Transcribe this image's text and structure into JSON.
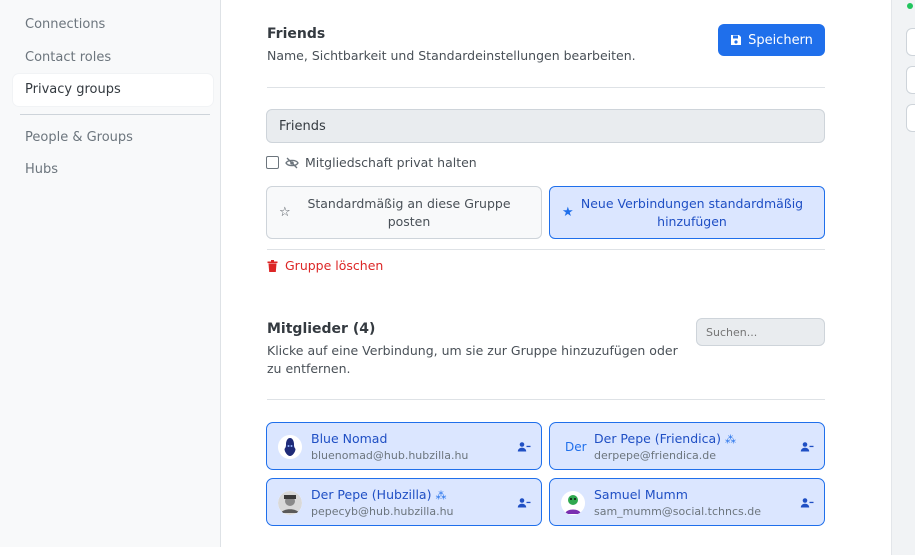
{
  "sidebar": {
    "items": [
      {
        "label": "Connections",
        "active": false
      },
      {
        "label": "Contact roles",
        "active": false
      },
      {
        "label": "Privacy groups",
        "active": true
      },
      {
        "label": "People & Groups",
        "active": false
      },
      {
        "label": "Hubs",
        "active": false
      }
    ]
  },
  "header": {
    "title": "Friends",
    "subtitle": "Name, Sichtbarkeit und Standardeinstellungen bearbeiten.",
    "save_label": "Speichern"
  },
  "group_form": {
    "name_value": "Friends",
    "private_membership_label": "Mitgliedschaft privat halten",
    "private_membership_checked": false,
    "default_post_label": "Standardmäßig an diese Gruppe posten",
    "default_post_active": false,
    "default_post_icon": "☆",
    "new_connections_label": "Neue Verbindungen standardmäßig hinzufügen",
    "new_connections_active": true,
    "new_connections_icon": "★",
    "delete_label": "Gruppe löschen"
  },
  "members": {
    "title": "Mitglieder (4)",
    "description": "Klicke auf eine Verbindung, um sie zur Gruppe hinzuzufügen oder zu entfernen.",
    "search_placeholder": "Suchen...",
    "list": [
      {
        "name": "Blue Nomad",
        "address": "bluenomad@hub.hubzilla.hu",
        "badge": "",
        "avatar": "blue-nomad-avatar"
      },
      {
        "name": "Der Pepe (Friendica)",
        "address": "derpepe@friendica.de",
        "badge": "⁂",
        "avatar_text": "Der"
      },
      {
        "name": "Der Pepe (Hubzilla)",
        "address": "pepecyb@hub.hubzilla.hu",
        "badge": "⁂",
        "avatar": "pepe-hubzilla-avatar"
      },
      {
        "name": "Samuel Mumm",
        "address": "sam_mumm@social.tchncs.de",
        "badge": "",
        "avatar": "samuel-mumm-avatar"
      }
    ]
  },
  "colors": {
    "accent": "#1f6feb",
    "danger": "#dc2626",
    "status_online": "#22c55e"
  }
}
